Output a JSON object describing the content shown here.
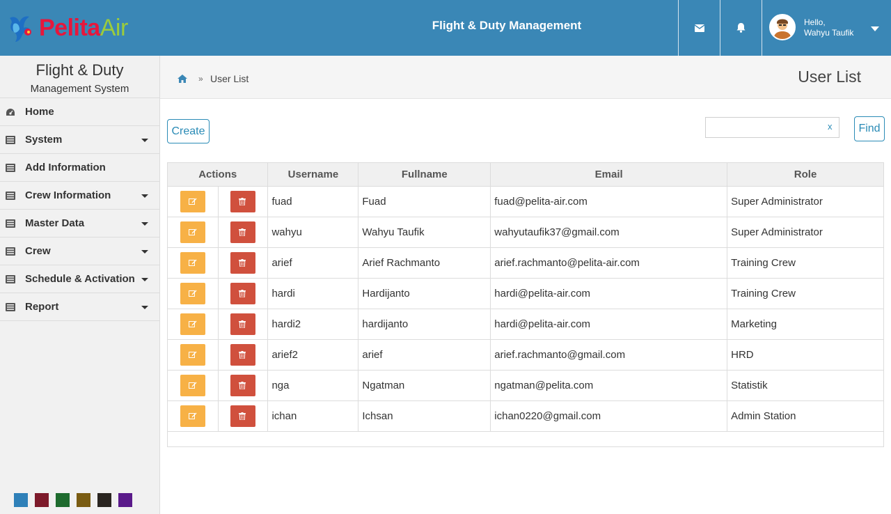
{
  "header": {
    "brand_part1": "Pelita",
    "brand_part2": "Air",
    "app_title": "Flight & Duty Management",
    "greeting": "Hello,",
    "user_name": "Wahyu Taufik"
  },
  "sidebar": {
    "title": "Flight & Duty",
    "subtitle": "Management System",
    "items": [
      {
        "label": "Home",
        "icon": "dashboard-icon",
        "has_submenu": false
      },
      {
        "label": "System",
        "icon": "list-icon",
        "has_submenu": true
      },
      {
        "label": "Add Information",
        "icon": "list-icon",
        "has_submenu": false
      },
      {
        "label": "Crew Information",
        "icon": "list-icon",
        "has_submenu": true
      },
      {
        "label": "Master Data",
        "icon": "list-icon",
        "has_submenu": true
      },
      {
        "label": "Crew",
        "icon": "list-icon",
        "has_submenu": true
      },
      {
        "label": "Schedule & Activation",
        "icon": "list-icon",
        "has_submenu": true
      },
      {
        "label": "Report",
        "icon": "list-icon",
        "has_submenu": true
      }
    ],
    "theme_colors": [
      "#2f80b8",
      "#7d1a2a",
      "#1e6b2e",
      "#7a5c12",
      "#2a2520",
      "#5a1a8a"
    ]
  },
  "breadcrumb": {
    "separator": "»",
    "current": "User List"
  },
  "page": {
    "title": "User List",
    "create_label": "Create",
    "find_label": "Find",
    "search_value": "",
    "clear_label": "x"
  },
  "table": {
    "columns": [
      "Actions",
      "Username",
      "Fullname",
      "Email",
      "Role"
    ],
    "rows": [
      {
        "username": "fuad",
        "fullname": "Fuad",
        "email": "fuad@pelita-air.com",
        "role": "Super Administrator"
      },
      {
        "username": "wahyu",
        "fullname": "Wahyu Taufik",
        "email": "wahyutaufik37@gmail.com",
        "role": "Super Administrator"
      },
      {
        "username": "arief",
        "fullname": "Arief Rachmanto",
        "email": "arief.rachmanto@pelita-air.com",
        "role": "Training Crew"
      },
      {
        "username": "hardi",
        "fullname": "Hardijanto",
        "email": "hardi@pelita-air.com",
        "role": "Training Crew"
      },
      {
        "username": "hardi2",
        "fullname": "hardijanto",
        "email": "hardi@pelita-air.com",
        "role": "Marketing"
      },
      {
        "username": "arief2",
        "fullname": "arief",
        "email": "arief.rachmanto@gmail.com",
        "role": "HRD"
      },
      {
        "username": "nga",
        "fullname": "Ngatman",
        "email": "ngatman@pelita.com",
        "role": "Statistik"
      },
      {
        "username": "ichan",
        "fullname": "Ichsan",
        "email": "ichan0220@gmail.com",
        "role": "Admin Station"
      }
    ]
  },
  "colors": {
    "topbar": "#3a87b6",
    "accent": "#2a8bb6",
    "edit_button": "#f7b146",
    "delete_button": "#d0503d"
  }
}
